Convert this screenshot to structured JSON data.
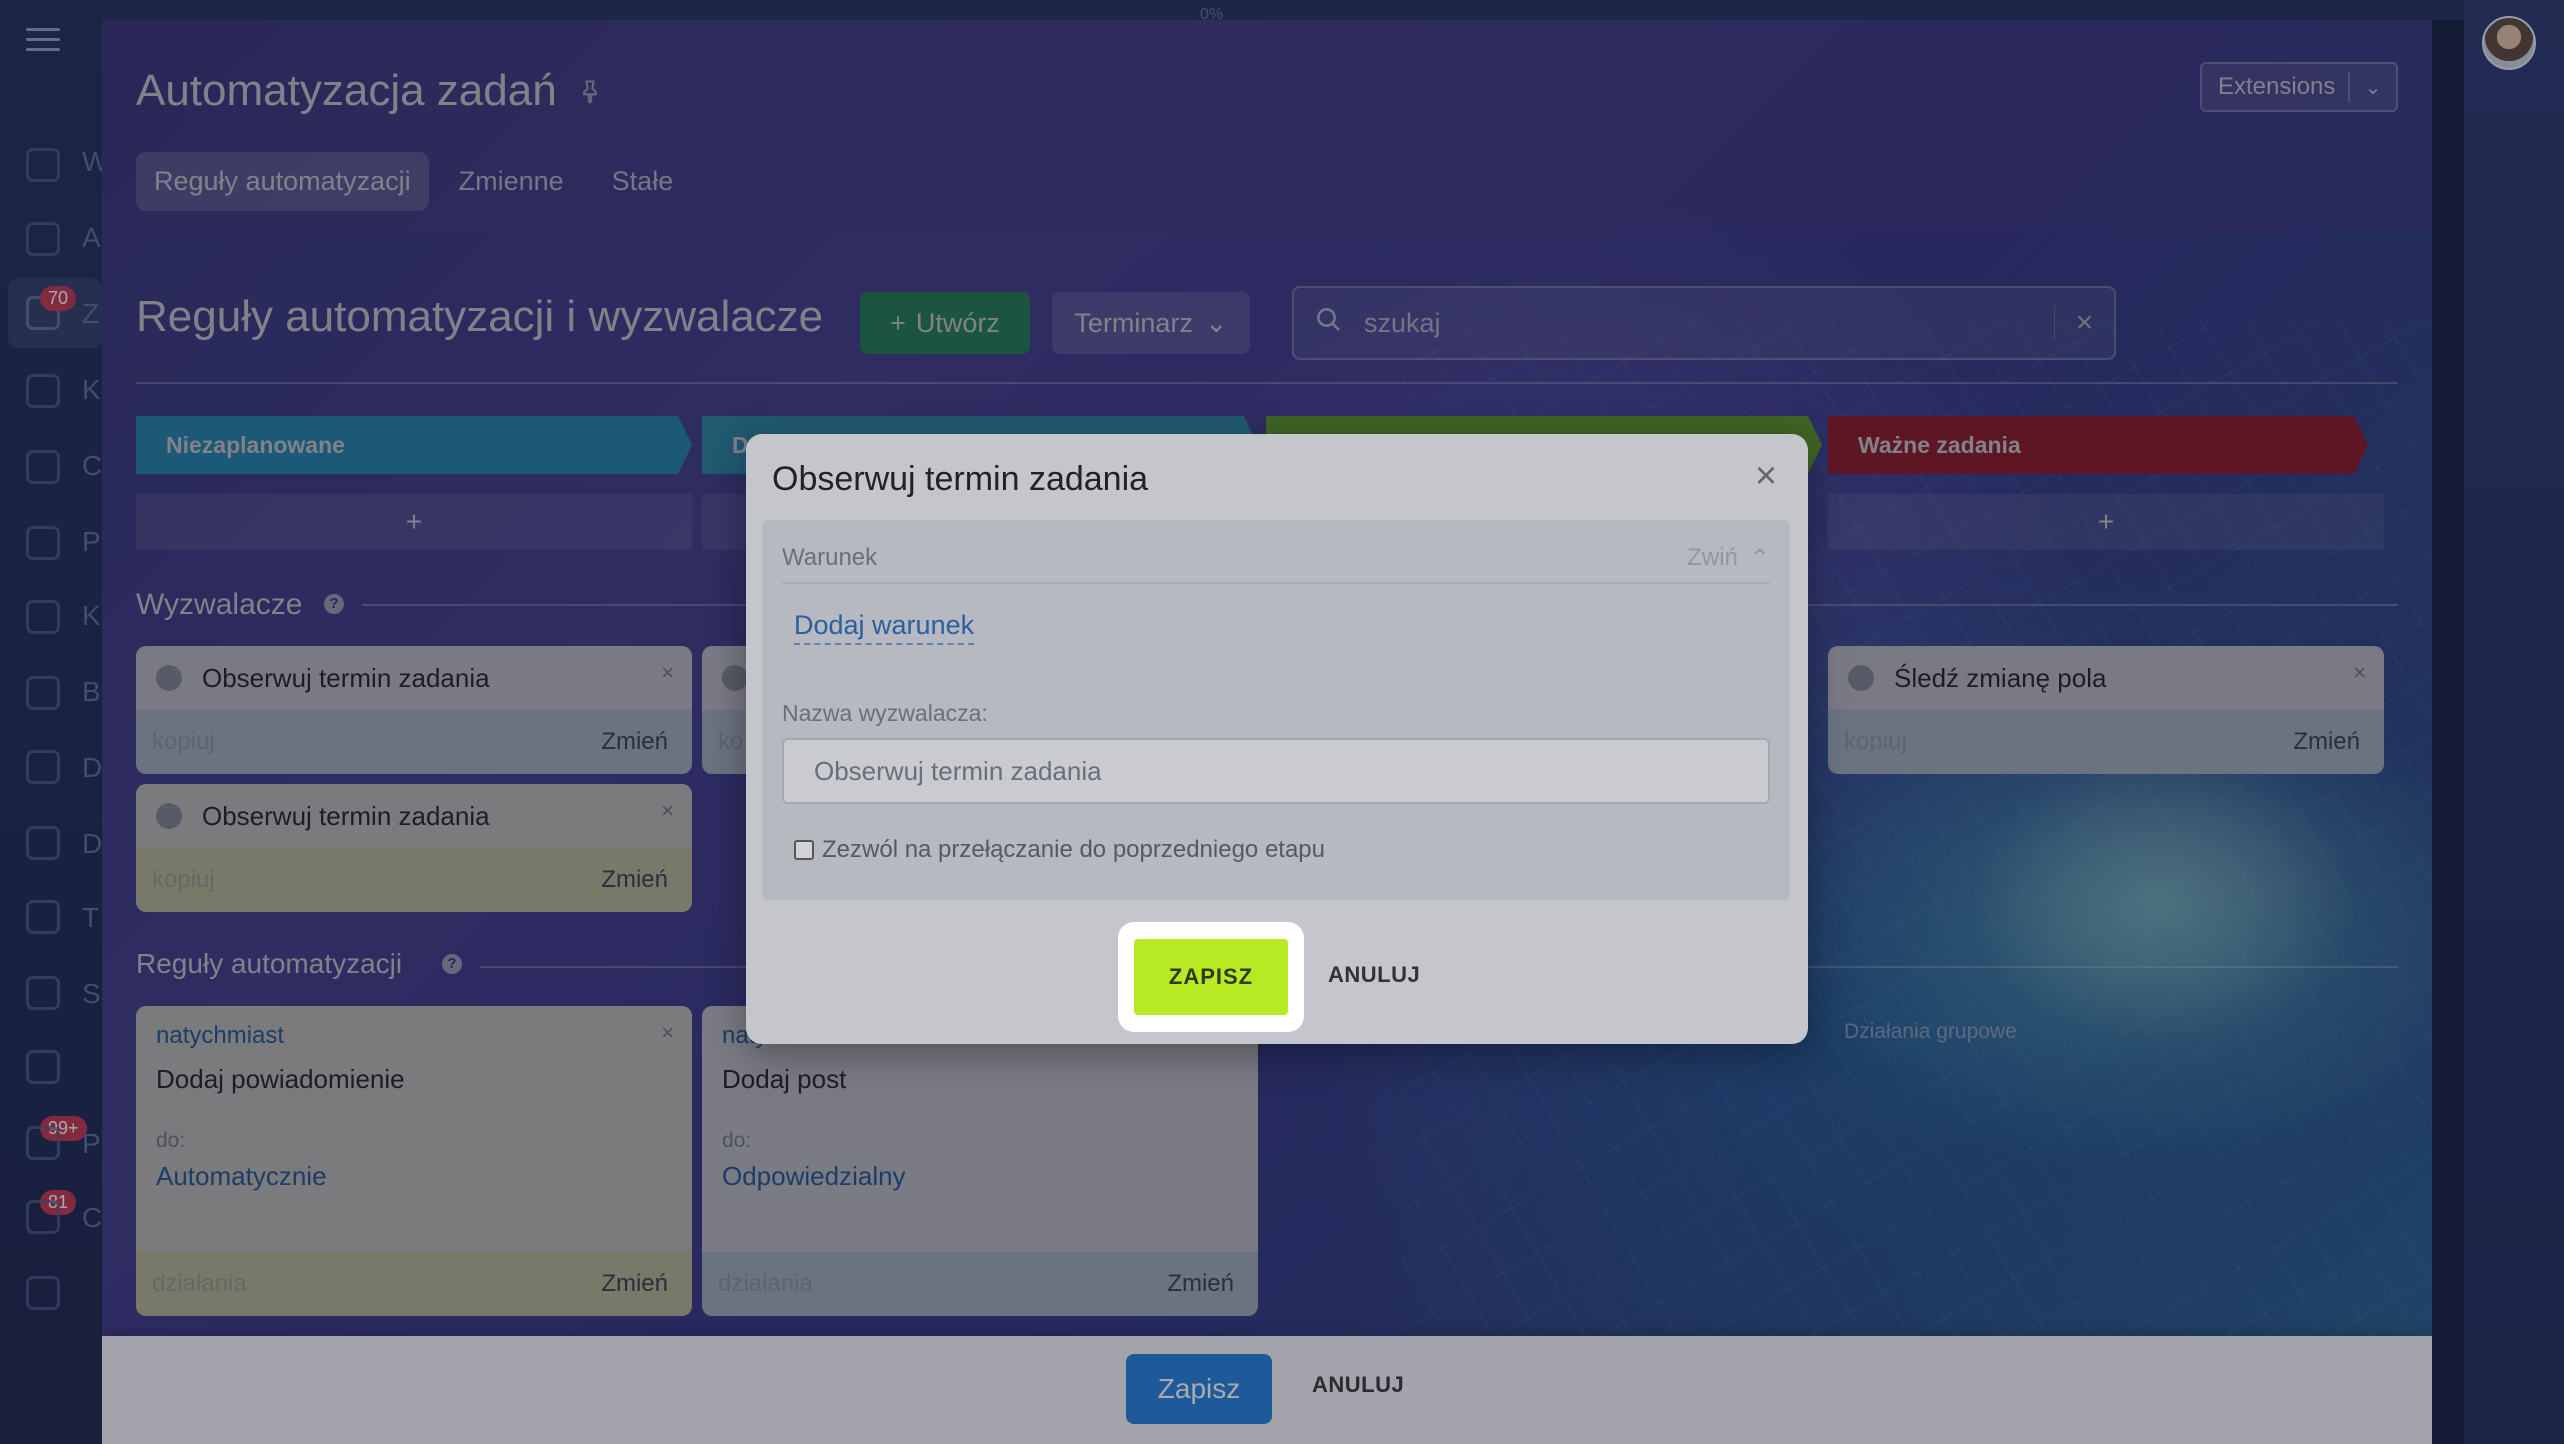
{
  "app": {
    "progress_label": "0%",
    "sidebar_letters": [
      "W",
      "A",
      "Z",
      "K",
      "C",
      "P",
      "K",
      "B",
      "D",
      "D",
      "T",
      "S",
      "P",
      "C"
    ],
    "tasks_badge": "70",
    "badge_2": "99+",
    "badge_3": "81"
  },
  "header": {
    "title": "Automatyzacja zadań",
    "extensions_label": "Extensions",
    "tabs": [
      {
        "label": "Reguły automatyzacji",
        "active": true
      },
      {
        "label": "Zmienne",
        "active": false
      },
      {
        "label": "Stałe",
        "active": false
      }
    ]
  },
  "toolbar": {
    "section_title": "Reguły automatyzacji i wyzwalacze",
    "create_label": "Utwórz",
    "schedule_label": "Terminarz",
    "search_placeholder": "szukaj"
  },
  "stages": [
    {
      "label": "Niezaplanowane",
      "color": "#1ea7d6"
    },
    {
      "label": "Do",
      "color": "#2aa9c9"
    },
    {
      "label": "",
      "color": "#6cc21f"
    },
    {
      "label": "Ważne zadania",
      "color": "#b4131d"
    }
  ],
  "stage_plus": "+",
  "triggers": {
    "title": "Wyzwalacze",
    "cards": [
      {
        "label": "Obserwuj termin zadania",
        "copy": "kopiuj",
        "change": "Zmień"
      },
      {
        "label": "",
        "copy": "ko",
        "change": ""
      },
      {
        "label": "Śledź zmianę pola",
        "copy": "kopiuj",
        "change": "Zmień"
      },
      {
        "label": "Obserwuj termin zadania",
        "copy": "kopiuj",
        "change": "Zmień"
      }
    ]
  },
  "rules": {
    "title": "Reguły automatyzacji",
    "group_actions": "Działania grupowe",
    "cards": [
      {
        "when": "natychmiast",
        "action": "Dodaj powiadomienie",
        "to_label": "do:",
        "to_value": "Automatycznie",
        "footer": "działania",
        "change": "Zmień"
      },
      {
        "when": "natychmiast",
        "action": "Dodaj post",
        "to_label": "do:",
        "to_value": "Odpowiedzialny",
        "footer": "działania",
        "change": "Zmień"
      }
    ]
  },
  "bottom": {
    "save_label": "Zapisz",
    "cancel_label": "ANULUJ"
  },
  "modal": {
    "title": "Obserwuj termin zadania",
    "condition_label": "Warunek",
    "collapse_label": "Zwiń",
    "add_condition": "Dodaj warunek",
    "name_label": "Nazwa wyzwalacza:",
    "name_value": "Obserwuj termin zadania",
    "allow_back_label": "Zezwól na przełączanie do poprzedniego etapu",
    "allow_back_checked": false,
    "save_label": "ZAPISZ",
    "cancel_label": "ANULUJ"
  }
}
